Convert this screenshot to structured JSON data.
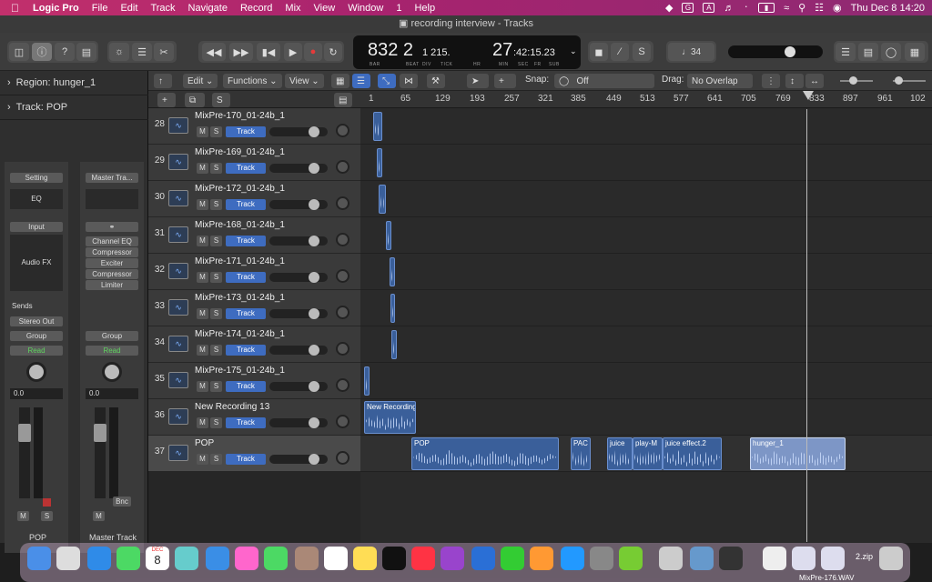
{
  "menubar": {
    "app_name": "Logic Pro",
    "items": [
      "File",
      "Edit",
      "Track",
      "Navigate",
      "Record",
      "Mix",
      "View",
      "Window",
      "1",
      "Help"
    ],
    "clock": "Thu Dec 8  14:20"
  },
  "window": {
    "title": "recording interview - Tracks"
  },
  "lcd": {
    "bar_beat": "832 2",
    "div_tick": "1 215.",
    "time_hr_min": "27",
    "time_sec": ":42:15.23",
    "labels": [
      "BAR",
      "BEAT",
      "DIV",
      "TICK",
      "HR",
      "MIN",
      "SEC",
      "FR",
      "SUB"
    ]
  },
  "toolbar": {
    "key_value": "♩34"
  },
  "inspector": {
    "region_label": "Region:",
    "region_name": "hunger_1",
    "track_label": "Track:",
    "track_name": "POP",
    "strip1": {
      "setting": "Setting",
      "eq": "EQ",
      "input": "Input",
      "audio_fx": "Audio FX",
      "sends": "Sends",
      "output": "Stereo Out",
      "group": "Group",
      "automation": "Read",
      "value": "0.0",
      "name": "POP",
      "m": "M",
      "s": "S"
    },
    "strip2": {
      "setting": "Master Tra...",
      "plugins": [
        "Channel EQ",
        "Compressor",
        "Exciter",
        "Compressor",
        "Limiter"
      ],
      "group": "Group",
      "automation": "Read",
      "value": "0.0",
      "bnc": "Bnc",
      "m": "M",
      "name": "Master Track"
    }
  },
  "edit_bar": {
    "edit": "Edit",
    "functions": "Functions",
    "view": "View",
    "snap_label": "Snap:",
    "snap_value": "Off",
    "drag_label": "Drag:",
    "drag_value": "No Overlap"
  },
  "track_header_top": {
    "s_button": "S"
  },
  "ruler_labels": [
    "1",
    "65",
    "129",
    "193",
    "257",
    "321",
    "385",
    "449",
    "513",
    "577",
    "641",
    "705",
    "769",
    "833",
    "897",
    "961",
    "102"
  ],
  "tracks": [
    {
      "num": "28",
      "name": "MixPre-170_01-24b_1"
    },
    {
      "num": "29",
      "name": "MixPre-169_01-24b_1"
    },
    {
      "num": "30",
      "name": "MixPre-172_01-24b_1"
    },
    {
      "num": "31",
      "name": "MixPre-168_01-24b_1"
    },
    {
      "num": "32",
      "name": "MixPre-171_01-24b_1"
    },
    {
      "num": "33",
      "name": "MixPre-173_01-24b_1"
    },
    {
      "num": "34",
      "name": "MixPre-174_01-24b_1"
    },
    {
      "num": "35",
      "name": "MixPre-175_01-24b_1"
    },
    {
      "num": "36",
      "name": "New Recording 13"
    },
    {
      "num": "37",
      "name": "POP"
    }
  ],
  "track_controls": {
    "m": "M",
    "s": "S",
    "track": "Track"
  },
  "regions": {
    "new_recording": "New Recording",
    "pop": "POP",
    "pac": "PAC",
    "juice": "juice",
    "play": "play-M",
    "juice_effect": "juice effect.2",
    "hunger": "hunger_1"
  },
  "dock": {
    "calendar_month": "DEC",
    "calendar_day": "8",
    "zip_label": "2.zip",
    "bottom_label": "MixPre-176.WAV"
  }
}
